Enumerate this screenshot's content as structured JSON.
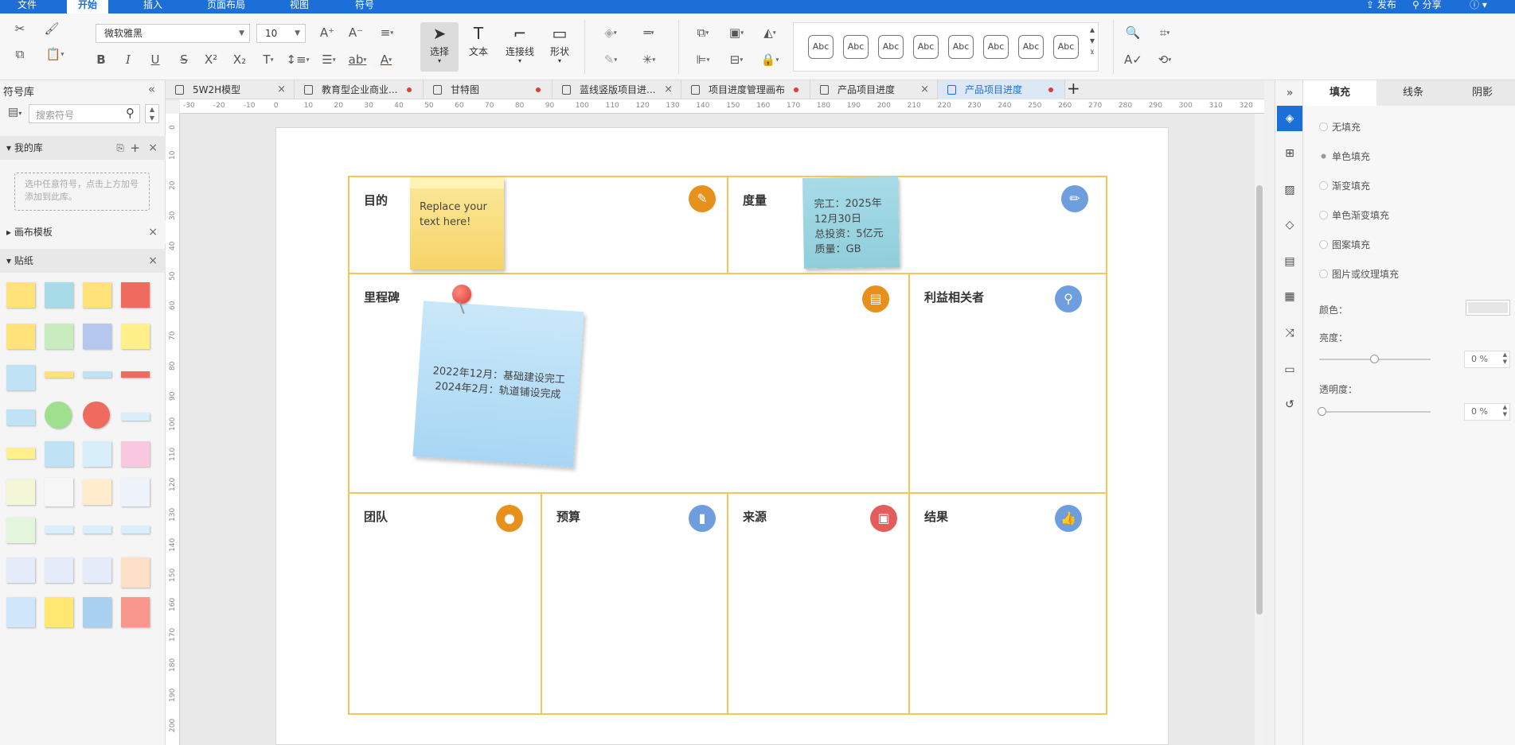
{
  "menu": {
    "items": [
      "文件",
      "开始",
      "插入",
      "页面布局",
      "视图",
      "符号"
    ],
    "publish": "发布",
    "share": "分享"
  },
  "toolbar": {
    "font": "微软雅黑",
    "size": "10",
    "select_label": "选择",
    "text_label": "文本",
    "connector_label": "连接线",
    "shape_label": "形状",
    "styles": [
      "Abc",
      "Abc",
      "Abc",
      "Abc",
      "Abc",
      "Abc",
      "Abc",
      "Abc"
    ]
  },
  "left": {
    "title": "符号库",
    "search_placeholder": "搜索符号",
    "mylib": "我的库",
    "hint": "选中任意符号，点击上方加号添加到此库。",
    "templates": "画布模板",
    "stickers": "贴纸"
  },
  "tabs": [
    {
      "label": "5W2H模型"
    },
    {
      "label": "教育型企业商业..."
    },
    {
      "label": "甘特图"
    },
    {
      "label": "蓝线竖版项目进..."
    },
    {
      "label": "项目进度管理画布"
    },
    {
      "label": "产品项目进度"
    },
    {
      "label": "产品项目进度"
    }
  ],
  "ruler": {
    "h": [
      "-30",
      "-20",
      "-10",
      "0",
      "10",
      "20",
      "30",
      "40",
      "50",
      "60",
      "70",
      "80",
      "90",
      "100",
      "110",
      "120",
      "130",
      "140",
      "150",
      "160",
      "170",
      "180",
      "190",
      "200",
      "210",
      "220",
      "230",
      "240",
      "250",
      "260",
      "270",
      "280",
      "290",
      "300",
      "310",
      "320"
    ],
    "v": [
      "0",
      "10",
      "20",
      "30",
      "40",
      "50",
      "60",
      "70",
      "80",
      "90",
      "100",
      "110",
      "120",
      "130",
      "140",
      "150",
      "160",
      "170",
      "180",
      "190",
      "200"
    ]
  },
  "canvas": {
    "purpose": "目的",
    "metrics": "度量",
    "milestone": "里程碑",
    "stakeholders": "利益相关者",
    "team": "团队",
    "budget": "预算",
    "source": "来源",
    "result": "结果",
    "note_purpose": "Replace your text here!",
    "note_metrics": [
      "完工：2025年",
      "12月30日",
      "总投资：5亿元",
      "质量：GB"
    ],
    "note_milestone": [
      "2022年12月：基础建设完工",
      "2024年2月：轨道铺设完成"
    ]
  },
  "colors": {
    "orange": "#e8901c",
    "blue": "#6f9ede",
    "red": "#e35d5d",
    "border": "#f5c758"
  },
  "right": {
    "tabs": [
      "填充",
      "线条",
      "阴影"
    ],
    "options": [
      "无填充",
      "单色填充",
      "渐变填充",
      "单色渐变填充",
      "图案填充",
      "图片或纹理填充"
    ],
    "color_label": "颜色：",
    "brightness_label": "亮度：",
    "brightness_value": "0 %",
    "opacity_label": "透明度：",
    "opacity_value": "0 %"
  }
}
